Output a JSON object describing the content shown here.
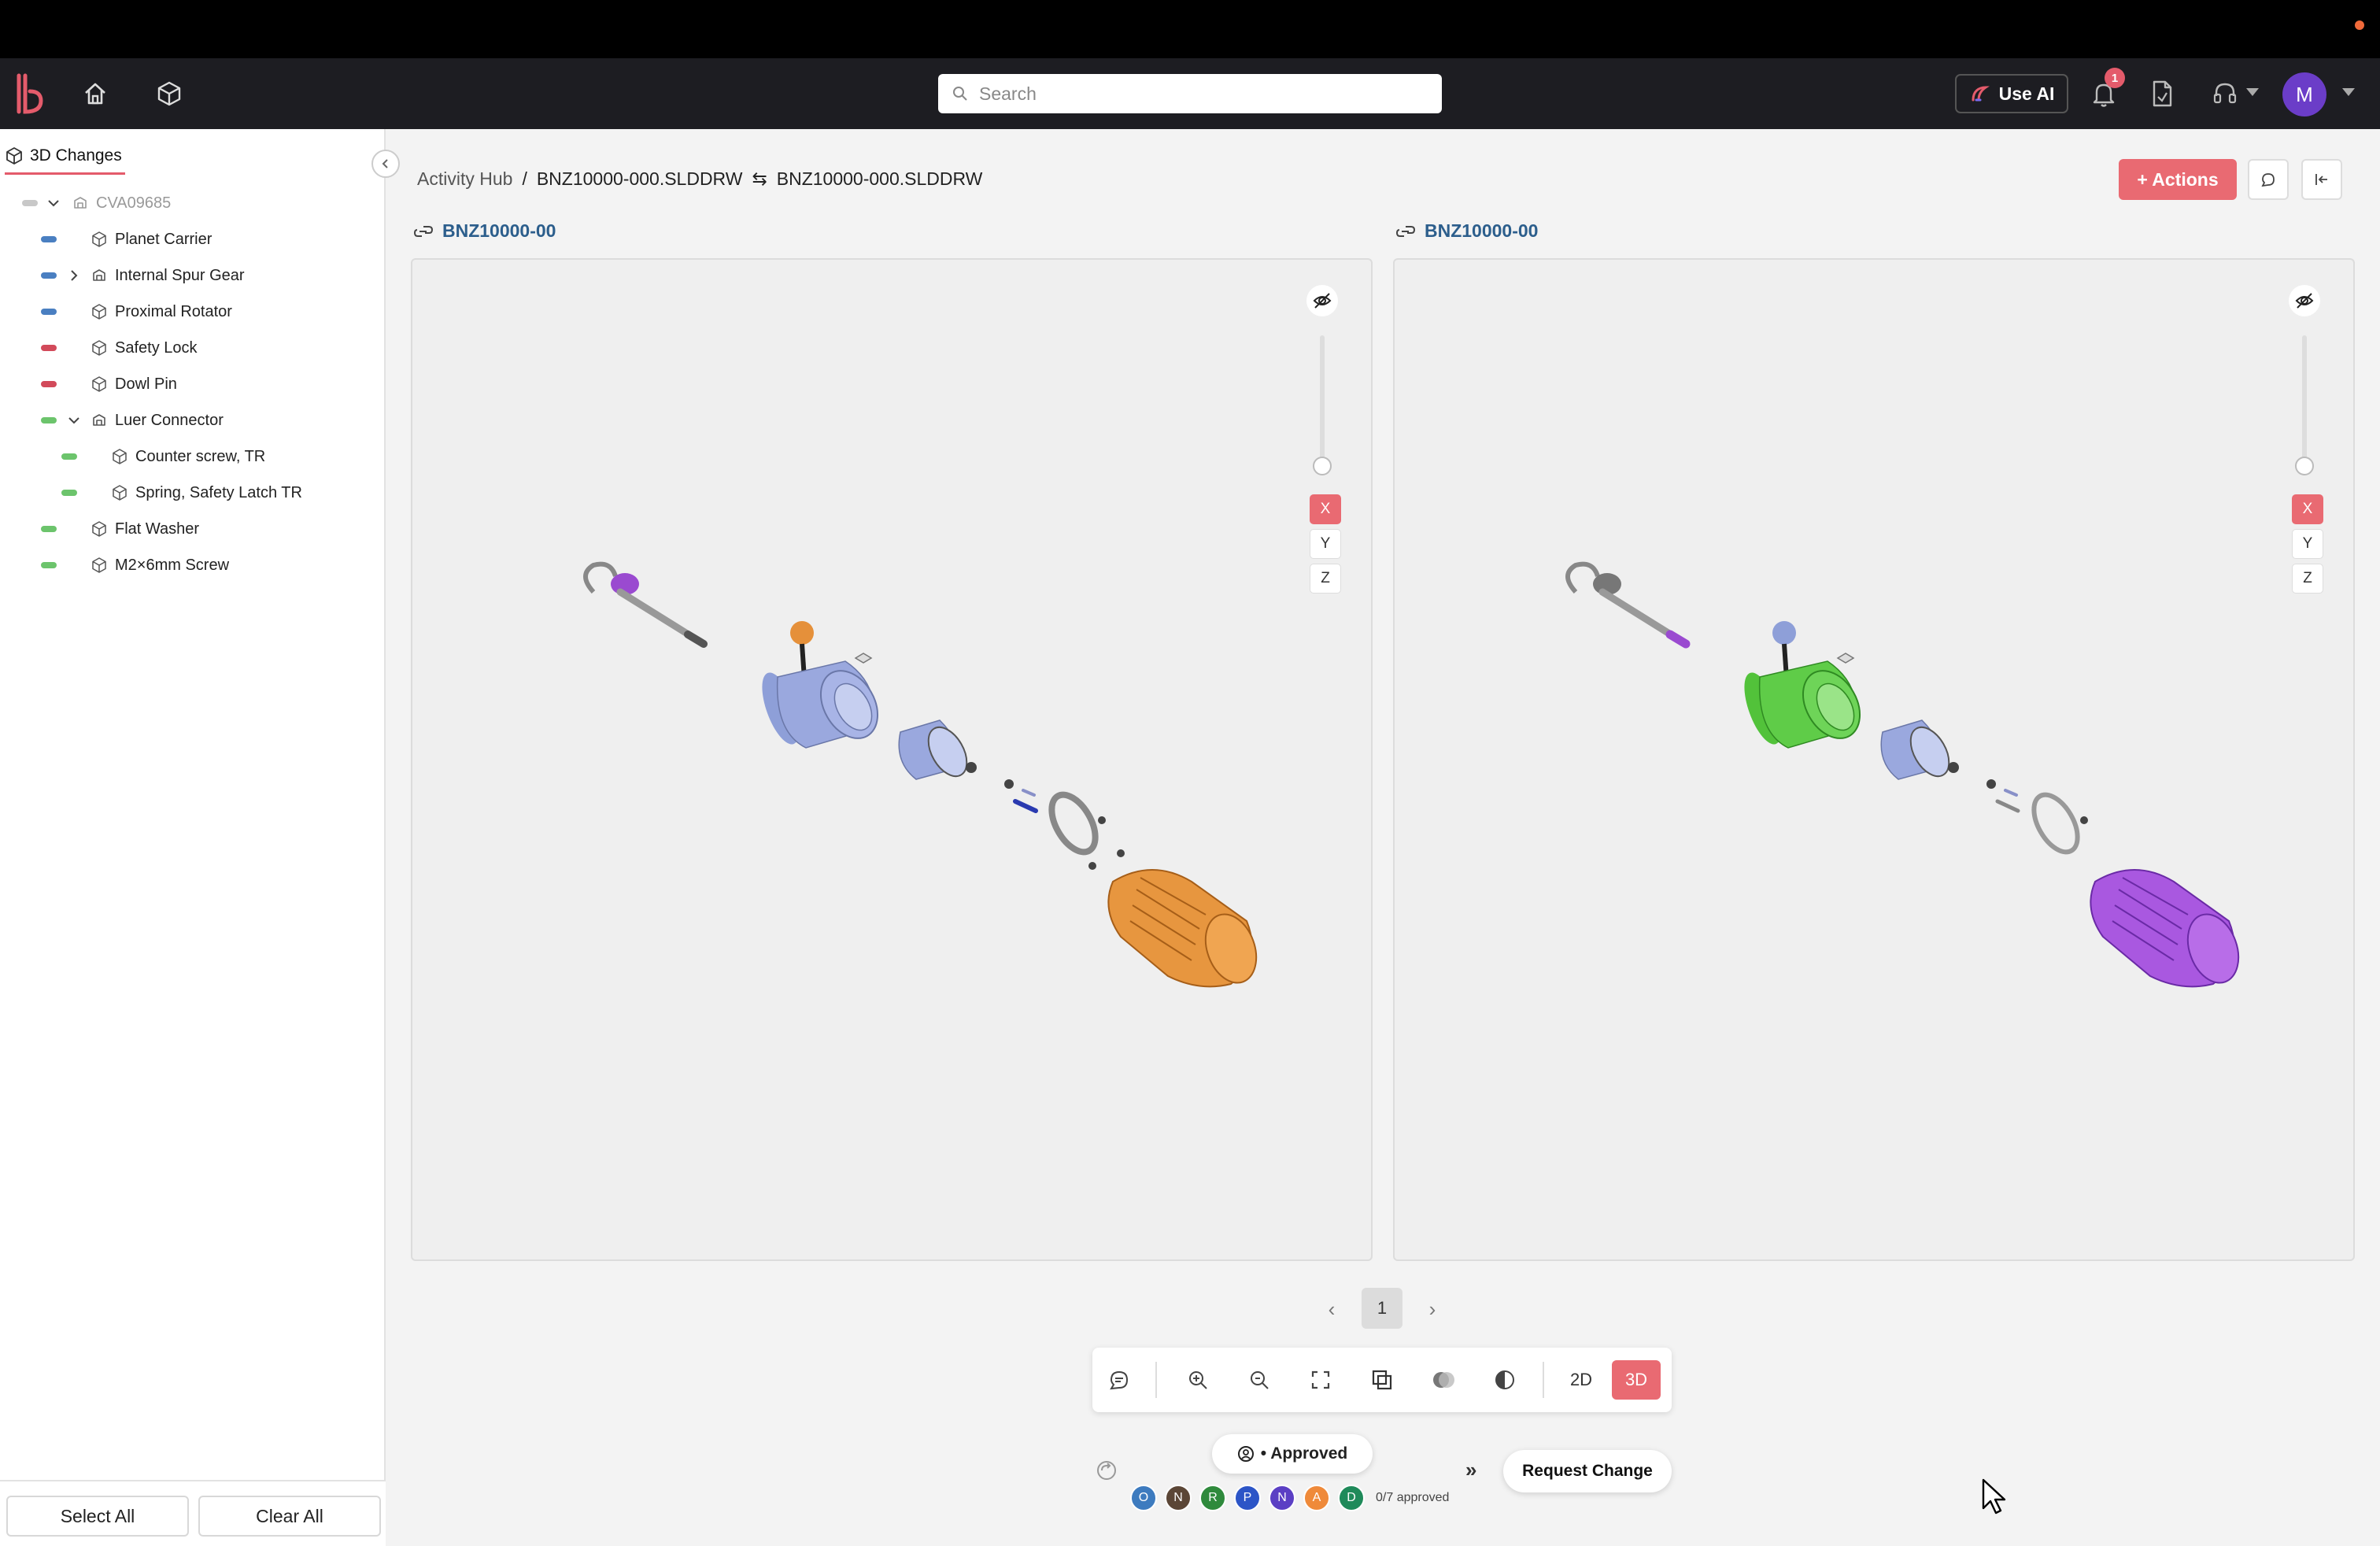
{
  "app": {
    "brand_color": "#e96a72"
  },
  "header": {
    "search_placeholder": "Search",
    "use_ai_label": "Use AI",
    "notification_count": "1",
    "avatar_initial": "M"
  },
  "sidebar": {
    "tab_label": "3D Changes",
    "items": [
      {
        "label": "CVA09685",
        "color": "#c8c8c8",
        "type": "assembly",
        "expanded": true,
        "level": 0
      },
      {
        "label": "Planet Carrier",
        "color": "#4a7fc1",
        "type": "part",
        "level": 1
      },
      {
        "label": "Internal Spur Gear",
        "color": "#4a7fc1",
        "type": "assembly",
        "expanded": false,
        "level": 1
      },
      {
        "label": "Proximal Rotator",
        "color": "#4a7fc1",
        "type": "part",
        "level": 1
      },
      {
        "label": "Safety Lock",
        "color": "#d24a5a",
        "type": "part",
        "level": 1
      },
      {
        "label": "Dowl Pin",
        "color": "#d24a5a",
        "type": "part",
        "level": 1
      },
      {
        "label": "Luer Connector",
        "color": "#6cc46c",
        "type": "assembly",
        "expanded": true,
        "level": 1
      },
      {
        "label": "Counter screw, TR",
        "color": "#6cc46c",
        "type": "part",
        "level": 2
      },
      {
        "label": "Spring, Safety Latch TR",
        "color": "#6cc46c",
        "type": "part",
        "level": 2
      },
      {
        "label": "Flat Washer",
        "color": "#6cc46c",
        "type": "part",
        "level": 1
      },
      {
        "label": "M2×6mm Screw",
        "color": "#6cc46c",
        "type": "part",
        "level": 1
      }
    ],
    "select_all_label": "Select All",
    "clear_all_label": "Clear All"
  },
  "breadcrumb": {
    "root": "Activity Hub",
    "separator": "/",
    "left_file": "BNZ10000-000.SLDDRW",
    "compare_symbol": "⇆",
    "right_file": "BNZ10000-000.SLDDRW"
  },
  "actions_label": "+ Actions",
  "panes": [
    {
      "title": "BNZ10000-00",
      "axes": [
        "X",
        "Y",
        "Z"
      ],
      "active_axis": "X"
    },
    {
      "title": "BNZ10000-00",
      "axes": [
        "X",
        "Y",
        "Z"
      ],
      "active_axis": "X"
    }
  ],
  "pagination": {
    "current_page": "1"
  },
  "toolbar": {
    "mode_2d": "2D",
    "mode_3d": "3D",
    "active_mode": "3D"
  },
  "approvals": {
    "status_label": "• Approved",
    "reviewers": [
      {
        "initial": "O",
        "color": "#3d7bbf"
      },
      {
        "initial": "N",
        "color": "#5b4636"
      },
      {
        "initial": "R",
        "color": "#2f8a3c"
      },
      {
        "initial": "P",
        "color": "#2c55c7"
      },
      {
        "initial": "N",
        "color": "#5b3fc4"
      },
      {
        "initial": "A",
        "color": "#ef8a3a"
      },
      {
        "initial": "D",
        "color": "#1f8a5a"
      }
    ],
    "approved_count": "0/7 approved",
    "request_change_label": "Request Change"
  }
}
